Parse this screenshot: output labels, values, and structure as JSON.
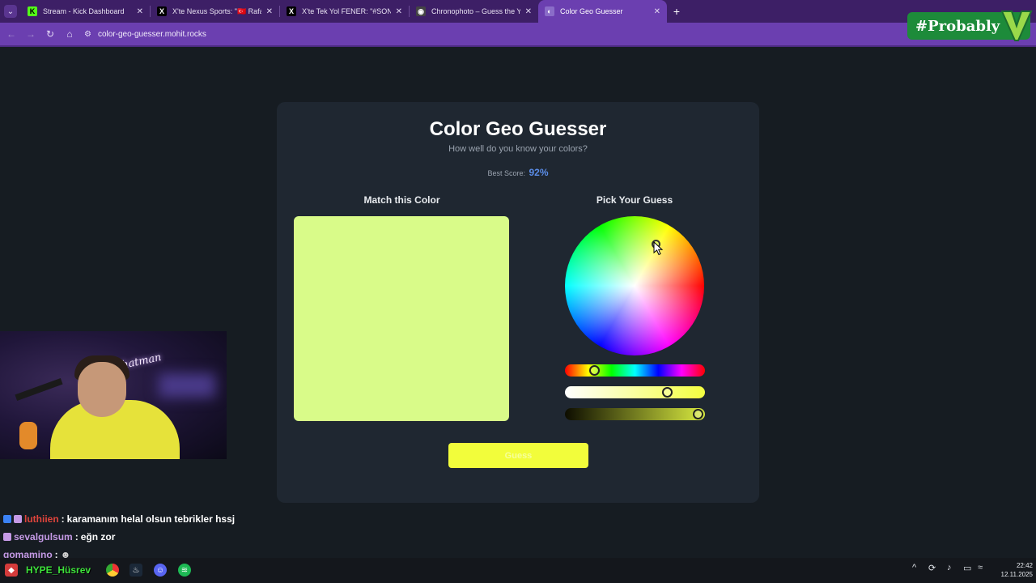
{
  "browser": {
    "tabs": [
      {
        "title": "Stream - Kick Dashboard",
        "icon": "kick-icon",
        "color": "#53fc18",
        "active": false
      },
      {
        "title": "X'te Nexus Sports: \"🇹🇷 Rafa Silv",
        "icon": "x-icon",
        "color": "#000000",
        "active": false
      },
      {
        "title": "X'te Tek Yol FENER: \"#SONDAKİ",
        "icon": "x-icon",
        "color": "#000000",
        "active": false
      },
      {
        "title": "Chronophoto – Guess the Year",
        "icon": "camera-icon",
        "color": "#444444",
        "active": false
      },
      {
        "title": "Color Geo Guesser",
        "icon": "globe-icon",
        "color": "#8a6cc8",
        "active": true
      }
    ],
    "url": "color-geo-guesser.mohit.rocks"
  },
  "overlay": {
    "probably": "#Probably"
  },
  "game": {
    "title": "Color Geo Guesser",
    "subtitle": "How well do you know your colors?",
    "best_score_label": "Best Score:",
    "best_score_value": "92%",
    "match_heading": "Match this Color",
    "pick_heading": "Pick Your Guess",
    "target_color": "#d9fb89",
    "sliders": {
      "hue_fraction": 0.21,
      "saturation_fraction": 0.73,
      "brightness_fraction": 0.95
    },
    "button_label": "Guess",
    "button_color": "#f2fd3b"
  },
  "webcam": {
    "neon_text": "hatman"
  },
  "chat": [
    {
      "user": "luthiien",
      "user_color": "#e0443c",
      "separator": ":",
      "message": "karamanım helal olsun tebrikler hssj"
    },
    {
      "user": "sevalgulsum",
      "user_color": "#c59ae6",
      "separator": ":",
      "message": "eğn zor"
    },
    {
      "user": "gomamino",
      "user_color": "#c59ae6",
      "separator": ":",
      "message": ""
    }
  ],
  "taskbar": {
    "hype_text": "HYPE_Hüsrev",
    "time": "22:42",
    "date": "12.11.2025"
  }
}
